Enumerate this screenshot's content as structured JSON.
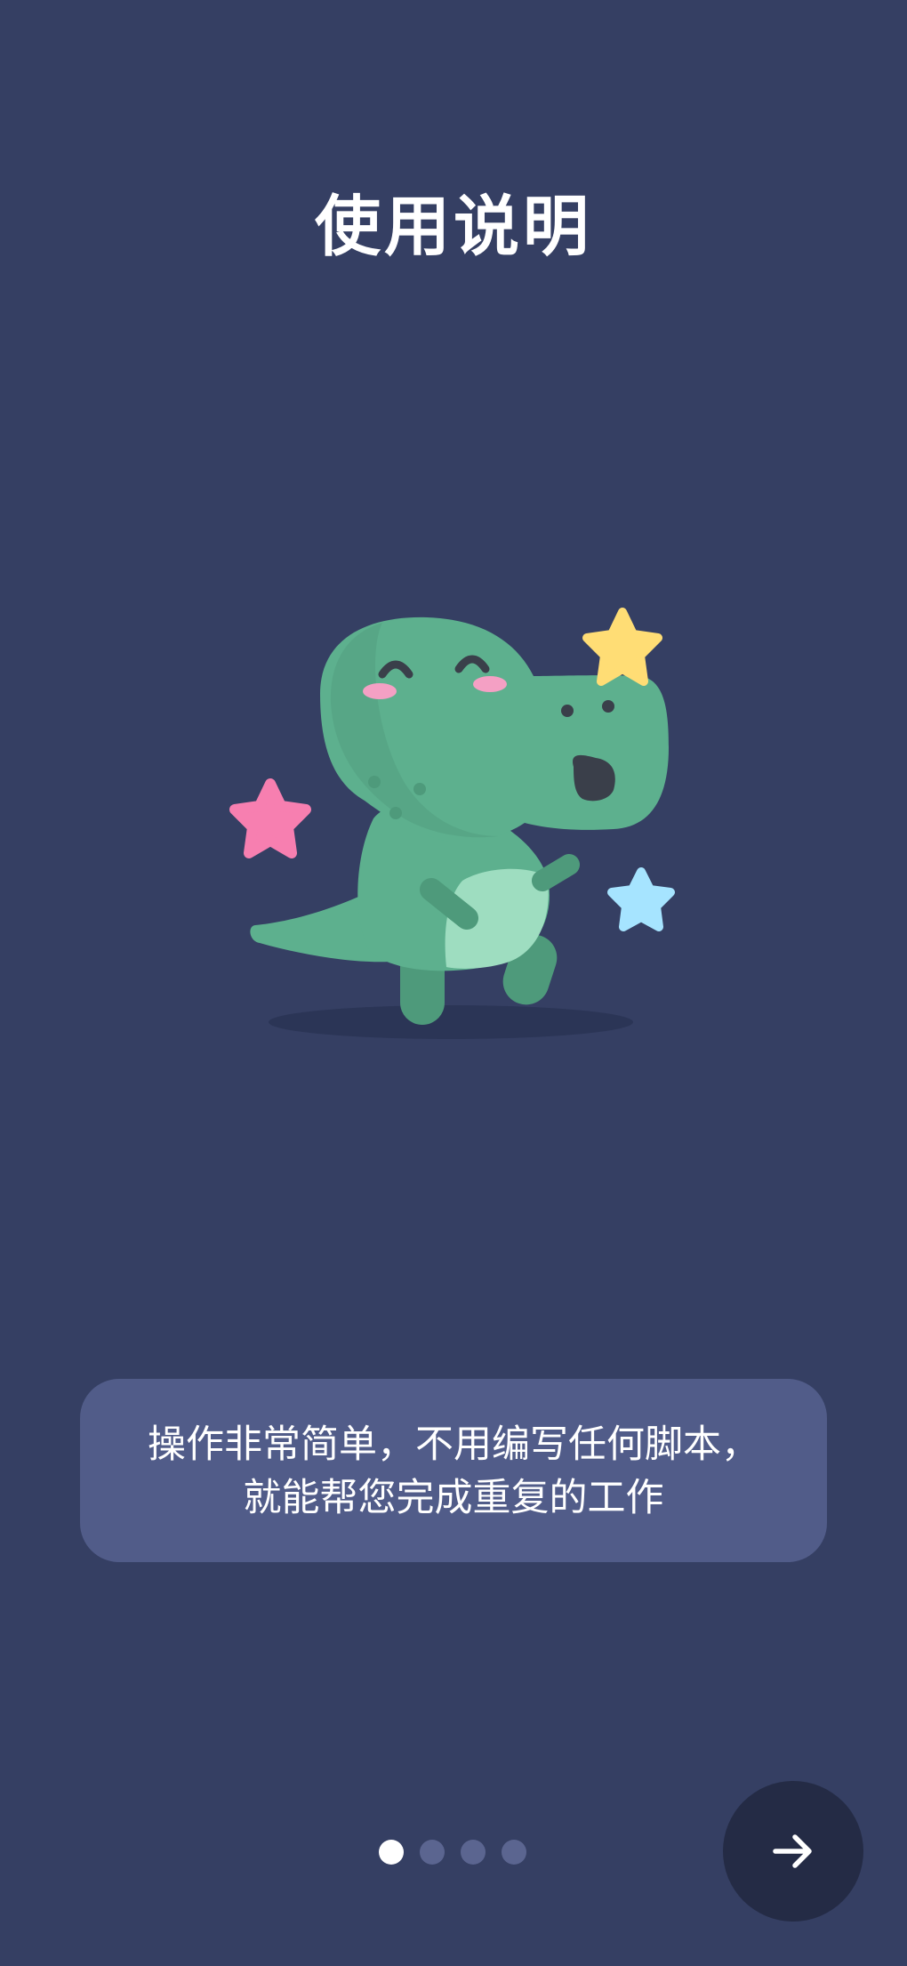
{
  "page": {
    "title": "使用说明"
  },
  "illustration": {
    "name": "dinosaur-with-stars",
    "colors": {
      "dino_body": "#5DB08E",
      "dino_dark": "#4E9A7B",
      "belly": "#9EDDC0",
      "cheeks": "#F4A0C4",
      "star_pink": "#F77FB0",
      "star_yellow": "#FFDD75",
      "star_blue": "#A6E4FF"
    }
  },
  "info_card": {
    "line1": "操作非常简单，不用编写任何脚本，",
    "line2": "就能帮您完成重复的工作"
  },
  "pager": {
    "total": 4,
    "current": 1
  },
  "next_button": {
    "icon": "arrow-right-icon"
  },
  "theme": {
    "background": "#353F63",
    "card": "#515C89",
    "button": "#242B45",
    "dot_inactive": "#5B6590",
    "dot_active": "#FFFFFF"
  }
}
